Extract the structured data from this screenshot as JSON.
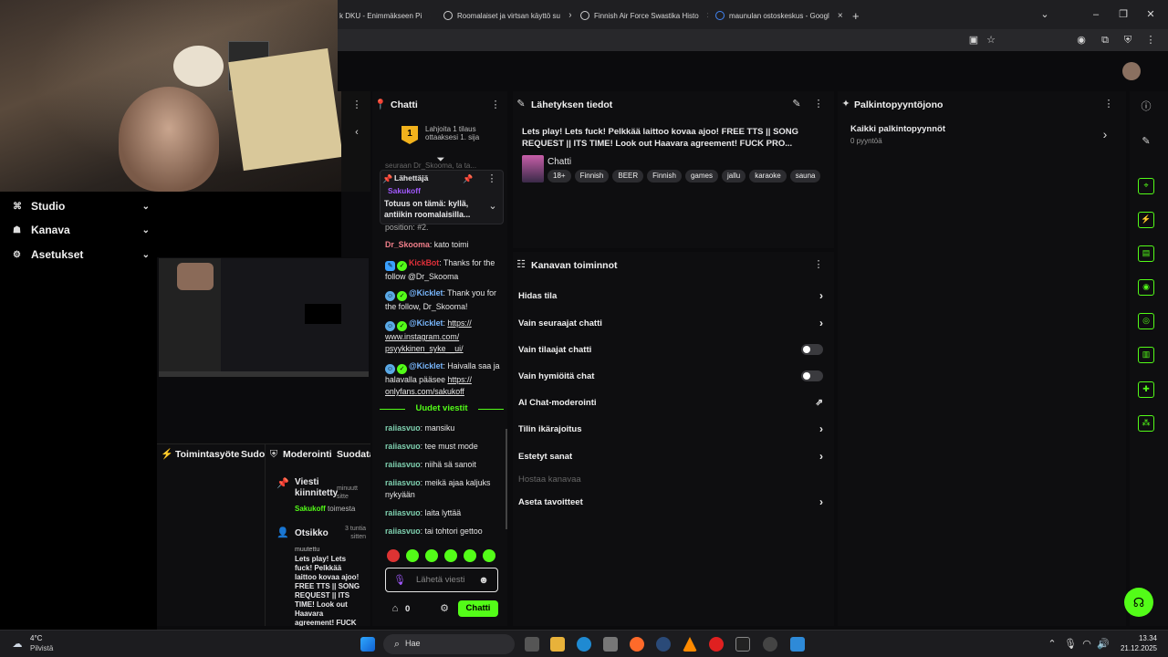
{
  "browser": {
    "tabs": [
      {
        "title": "k DKU - Enimmäkseen Pi",
        "close": "×"
      },
      {
        "title": "Roomalaiset ja virtsan käyttö su",
        "close": "×"
      },
      {
        "title": "Finnish Air Force Swastika Histo",
        "close": "×"
      },
      {
        "title": "maunulan ostoskeskus - Googl",
        "close": "×"
      }
    ],
    "new_tab": "+"
  },
  "studio_nav": [
    {
      "label": "Studio",
      "icon": "studio-icon"
    },
    {
      "label": "Kanava",
      "icon": "channel-icon"
    },
    {
      "label": "Asetukset",
      "icon": "settings-icon"
    }
  ],
  "activity": {
    "title": "Toimintasyöte",
    "second_title": "Sudo"
  },
  "moderation": {
    "title": "Moderointi",
    "second_title": "Suodata",
    "pinned_title": "Viesti kiinnitetty",
    "pinned_time": "minuutt sitte",
    "pinned_by_user": "Sakukoff",
    "pinned_by_text": "toimesta",
    "title_change": "Otsikko",
    "title_change_time": "3 tuntia sitten",
    "changed_label": "muutettu",
    "changed_text": "Lets play! Lets fuck! Pelkkää laittoo kovaa ajoo! FREE TTS || SONG REQUEST || ITS TIME! Look out Haavara agreement! FUCK"
  },
  "chat": {
    "title": "Chatti",
    "sub_rank": "1",
    "sub_gift": "Lahjoita 1 tilaus ottaaksesi 1. sija",
    "faded_line": "seuraan Dr_Skooma, ta ta...",
    "pinned_label": "Lähettäjä",
    "pinned_user": "Sakukoff",
    "pinned_message": "Totuus on tämä: kyllä, antiikin roomalaisilla...",
    "position_text": "position: #2.",
    "messages": [
      {
        "user": "Dr_Skooma",
        "text": "kato toimi"
      },
      {
        "user": "KickBot",
        "text": "Thanks for the follow @Dr_Skooma"
      },
      {
        "user": "@Kicklet",
        "text": "Thank you for the follow, Dr_Skooma!"
      },
      {
        "user": "@Kicklet",
        "text": "https:// www.instagram.com/ psyykkinen_syke__ui/"
      },
      {
        "user": "@Kicklet",
        "text": "Haivalla saa ja halavalla pääsee",
        "link": "https:// onlyfans.com/sakukoff"
      }
    ],
    "new_messages_label": "Uudet viestit",
    "new_messages": [
      {
        "user": "raiiasvuo",
        "text": "mansiku"
      },
      {
        "user": "raiiasvuo",
        "text": "tee must mode"
      },
      {
        "user": "raiiasvuo",
        "text": "niihä sä sanoit"
      },
      {
        "user": "raiiasvuo",
        "text": "meikä ajaa kaljuks nykyään"
      },
      {
        "user": "raiiasvuo",
        "text": "laita lyttää"
      },
      {
        "user": "raiiasvuo",
        "text": "tai tohtori gettoo"
      }
    ],
    "input_placeholder": "Lähetä viesti",
    "points": "0",
    "send_label": "Chatti"
  },
  "stream_info": {
    "title": "Lähetyksen tiedot",
    "stream_title": "Lets play! Lets fuck! Pelkkää laittoo kovaa ajoo! FREE TTS || SONG REQUEST || ITS TIME! Look out Haavara agreement! FUCK PRO...",
    "category": "Chatti",
    "tags": [
      "18+",
      "Finnish",
      "BEER",
      "Finnish",
      "games",
      "jallu",
      "karaoke",
      "sauna"
    ]
  },
  "channel_actions": {
    "title": "Kanavan toiminnot",
    "items": [
      {
        "label": "Hidas tila",
        "control": "chevron"
      },
      {
        "label": "Vain seuraajat chatti",
        "control": "chevron"
      },
      {
        "label": "Vain tilaajat chatti",
        "control": "toggle"
      },
      {
        "label": "Vain hymiöitä chat",
        "control": "toggle"
      },
      {
        "label": "AI Chat-moderointi",
        "control": "external"
      },
      {
        "label": "Tilin ikärajoitus",
        "control": "chevron"
      },
      {
        "label": "Estetyt sanat",
        "control": "chevron"
      },
      {
        "label": "Hostaa kanavaa",
        "control": "none"
      },
      {
        "label": "Aseta tavoitteet",
        "control": "chevron"
      }
    ]
  },
  "rewards": {
    "title": "Palkintopyyntöjono",
    "all_requests": "Kaikki palkintopyynnöt",
    "count": "0 pyyntöä"
  },
  "taskbar": {
    "temperature": "4°C",
    "weather": "Pilvistä",
    "search": "Hae",
    "time": "13.34",
    "date": "21.12.2025"
  },
  "colors": {
    "accent": "#53fc18",
    "background": "#0e0e10",
    "panel": "#18181b"
  }
}
